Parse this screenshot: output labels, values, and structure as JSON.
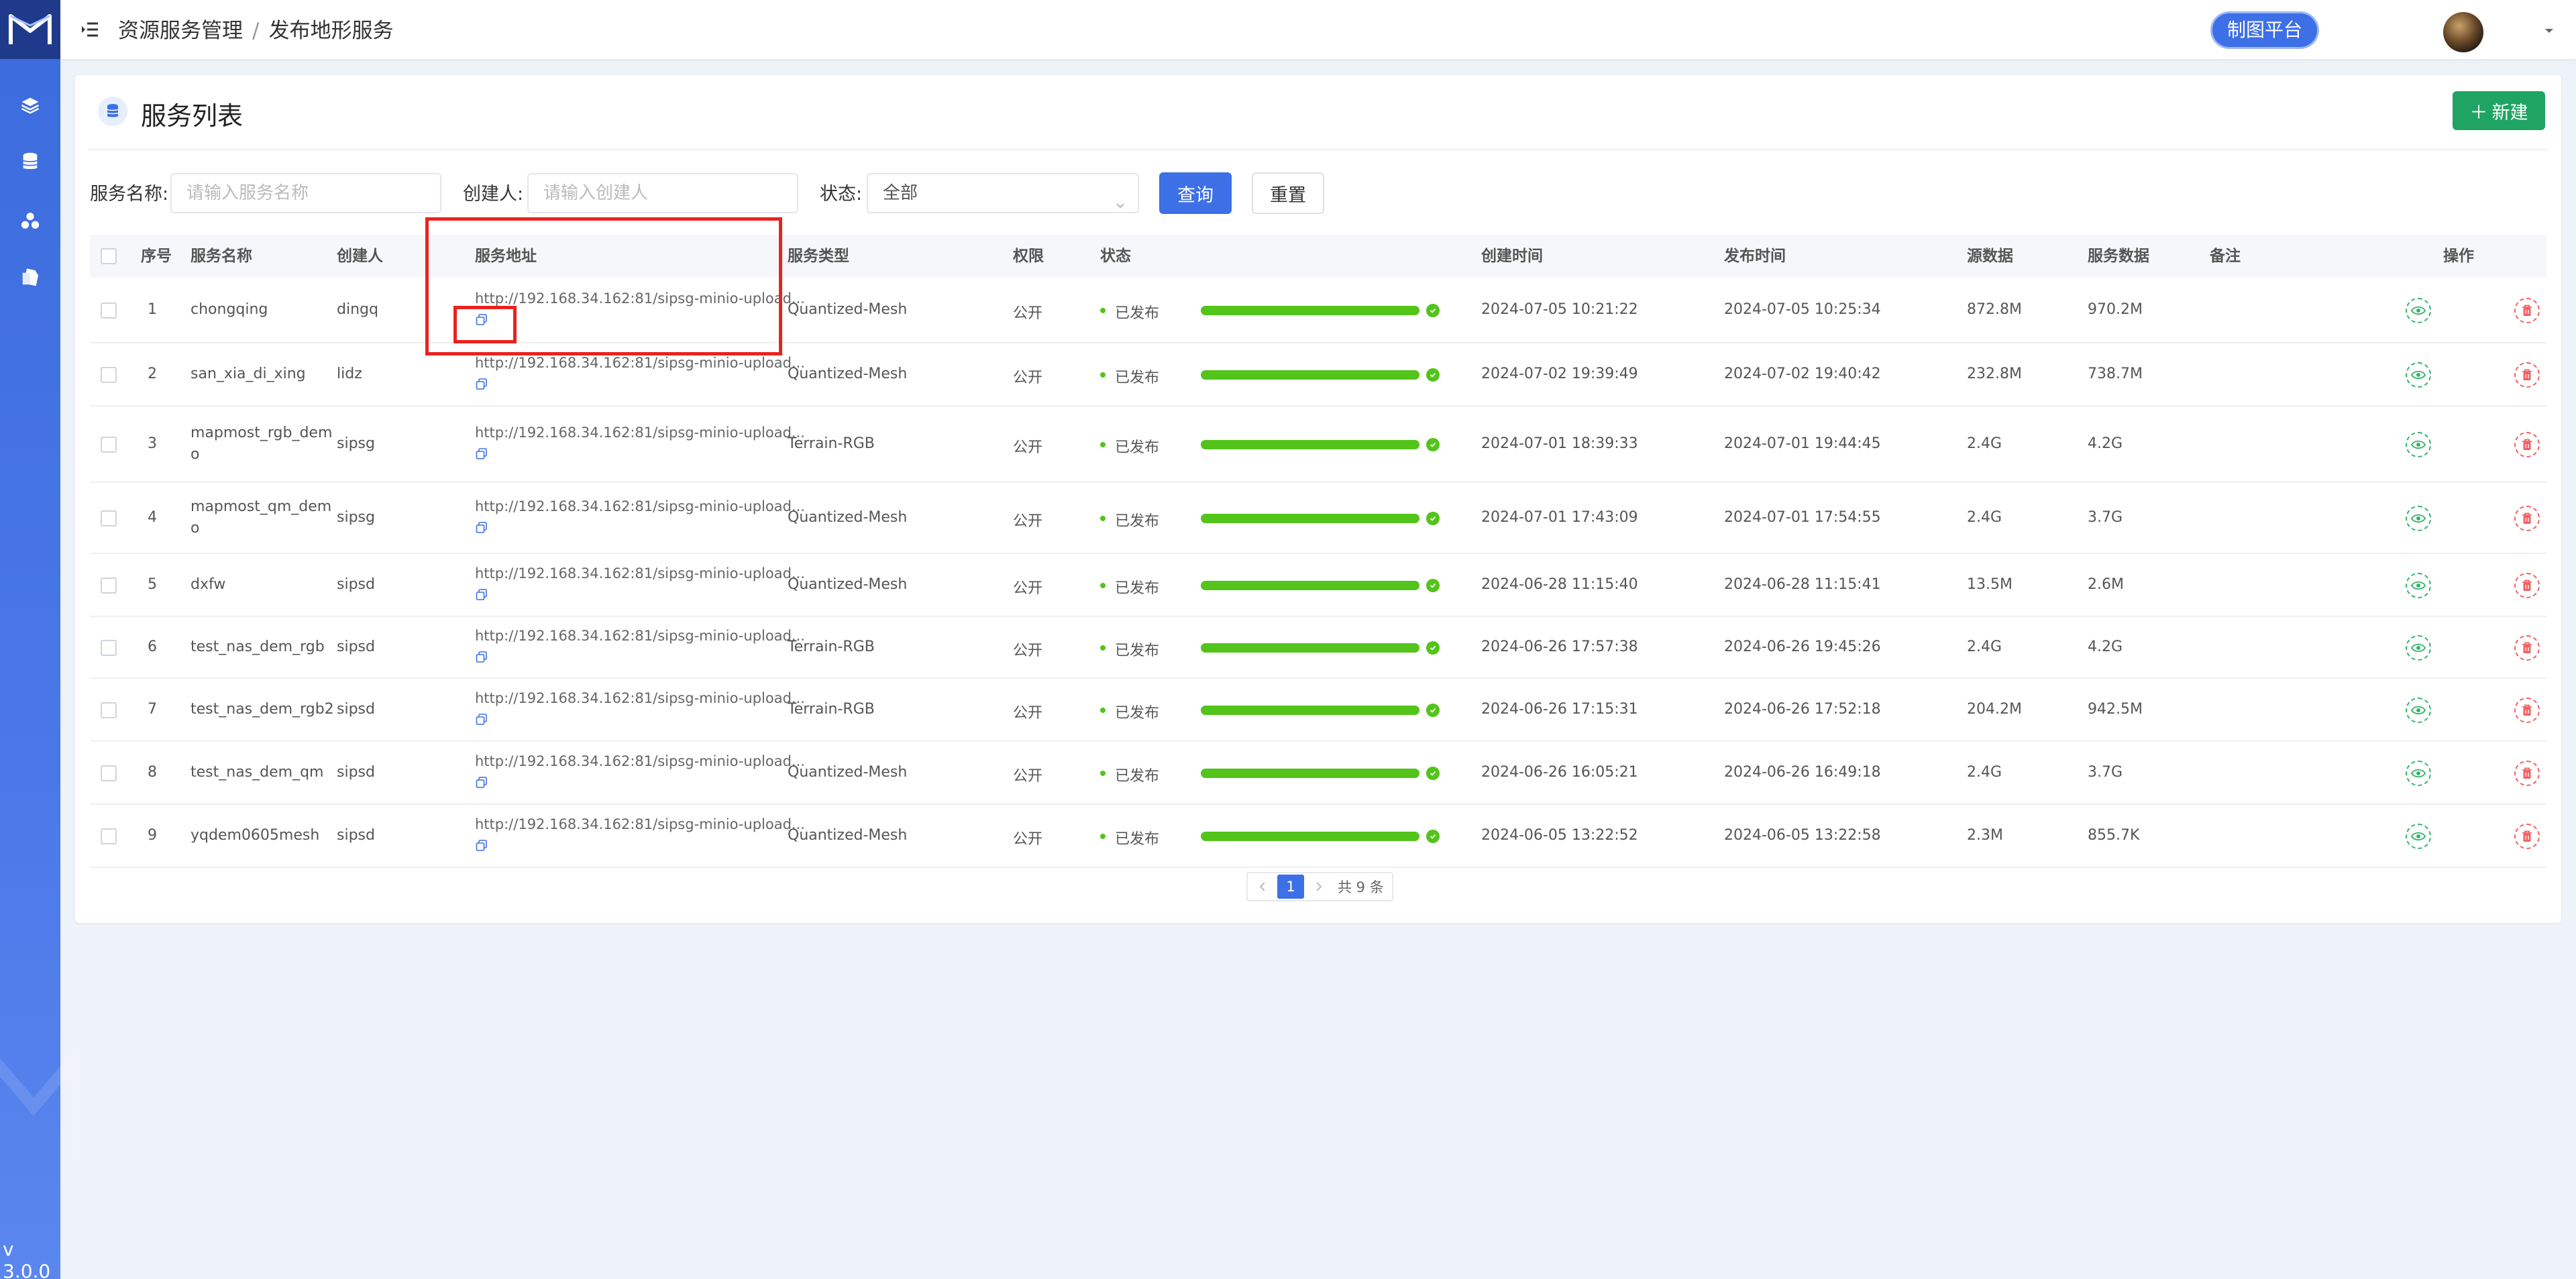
{
  "sidebar": {
    "version": "v 3.0.0",
    "icons": [
      "layers-icon",
      "database-icon",
      "cluster-icon",
      "file-icon"
    ]
  },
  "header": {
    "breadcrumb": [
      "资源服务管理",
      "发布地形服务"
    ],
    "platform_button": "制图平台"
  },
  "card": {
    "title": "服务列表",
    "new_button": "新建"
  },
  "filters": {
    "name_label": "服务名称:",
    "name_placeholder": "请输入服务名称",
    "creator_label": "创建人:",
    "creator_placeholder": "请输入创建人",
    "status_label": "状态:",
    "status_value": "全部",
    "query_button": "查询",
    "reset_button": "重置"
  },
  "table": {
    "columns": [
      "序号",
      "服务名称",
      "创建人",
      "服务地址",
      "服务类型",
      "权限",
      "状态",
      "创建时间",
      "发布时间",
      "源数据",
      "服务数据",
      "备注",
      "操作"
    ],
    "rows": [
      {
        "index": "1",
        "name": [
          "chongqing"
        ],
        "creator": "dingq",
        "url": "http://192.168.34.162:81/sipsg-minio-upload...",
        "type": "Quantized-Mesh",
        "permission": "公开",
        "status": "已发布",
        "progress": 100,
        "created": "2024-07-05 10:21:22",
        "published": "2024-07-05 10:25:34",
        "source_size": "872.8M",
        "service_size": "970.2M"
      },
      {
        "index": "2",
        "name": [
          "san_xia_di_xing"
        ],
        "creator": "lidz",
        "url": "http://192.168.34.162:81/sipsg-minio-upload...",
        "type": "Quantized-Mesh",
        "permission": "公开",
        "status": "已发布",
        "progress": 100,
        "created": "2024-07-02 19:39:49",
        "published": "2024-07-02 19:40:42",
        "source_size": "232.8M",
        "service_size": "738.7M"
      },
      {
        "index": "3",
        "name": [
          "mapmost_rgb_dem",
          "o"
        ],
        "creator": "sipsg",
        "url": "http://192.168.34.162:81/sipsg-minio-upload...",
        "type": "Terrain-RGB",
        "permission": "公开",
        "status": "已发布",
        "progress": 100,
        "created": "2024-07-01 18:39:33",
        "published": "2024-07-01 19:44:45",
        "source_size": "2.4G",
        "service_size": "4.2G"
      },
      {
        "index": "4",
        "name": [
          "mapmost_qm_dem",
          "o"
        ],
        "creator": "sipsg",
        "url": "http://192.168.34.162:81/sipsg-minio-upload...",
        "type": "Quantized-Mesh",
        "permission": "公开",
        "status": "已发布",
        "progress": 100,
        "created": "2024-07-01 17:43:09",
        "published": "2024-07-01 17:54:55",
        "source_size": "2.4G",
        "service_size": "3.7G"
      },
      {
        "index": "5",
        "name": [
          "dxfw"
        ],
        "creator": "sipsd",
        "url": "http://192.168.34.162:81/sipsg-minio-upload...",
        "type": "Quantized-Mesh",
        "permission": "公开",
        "status": "已发布",
        "progress": 100,
        "created": "2024-06-28 11:15:40",
        "published": "2024-06-28 11:15:41",
        "source_size": "13.5M",
        "service_size": "2.6M"
      },
      {
        "index": "6",
        "name": [
          "test_nas_dem_rgb"
        ],
        "creator": "sipsd",
        "url": "http://192.168.34.162:81/sipsg-minio-upload...",
        "type": "Terrain-RGB",
        "permission": "公开",
        "status": "已发布",
        "progress": 100,
        "created": "2024-06-26 17:57:38",
        "published": "2024-06-26 19:45:26",
        "source_size": "2.4G",
        "service_size": "4.2G"
      },
      {
        "index": "7",
        "name": [
          "test_nas_dem_rgb2"
        ],
        "creator": "sipsd",
        "url": "http://192.168.34.162:81/sipsg-minio-upload...",
        "type": "Terrain-RGB",
        "permission": "公开",
        "status": "已发布",
        "progress": 100,
        "created": "2024-06-26 17:15:31",
        "published": "2024-06-26 17:52:18",
        "source_size": "204.2M",
        "service_size": "942.5M"
      },
      {
        "index": "8",
        "name": [
          "test_nas_dem_qm"
        ],
        "creator": "sipsd",
        "url": "http://192.168.34.162:81/sipsg-minio-upload...",
        "type": "Quantized-Mesh",
        "permission": "公开",
        "status": "已发布",
        "progress": 100,
        "created": "2024-06-26 16:05:21",
        "published": "2024-06-26 16:49:18",
        "source_size": "2.4G",
        "service_size": "3.7G"
      },
      {
        "index": "9",
        "name": [
          "yqdem0605mesh"
        ],
        "creator": "sipsd",
        "url": "http://192.168.34.162:81/sipsg-minio-upload...",
        "type": "Quantized-Mesh",
        "permission": "公开",
        "status": "已发布",
        "progress": 100,
        "created": "2024-06-05 13:22:52",
        "published": "2024-06-05 13:22:58",
        "source_size": "2.3M",
        "service_size": "855.7K"
      }
    ]
  },
  "pagination": {
    "current": "1",
    "total": "共 9 条"
  },
  "colors": {
    "primary": "#3d6fe6",
    "success": "#52c41a",
    "new_button": "#1fa463",
    "annotation": "#e8231f"
  }
}
